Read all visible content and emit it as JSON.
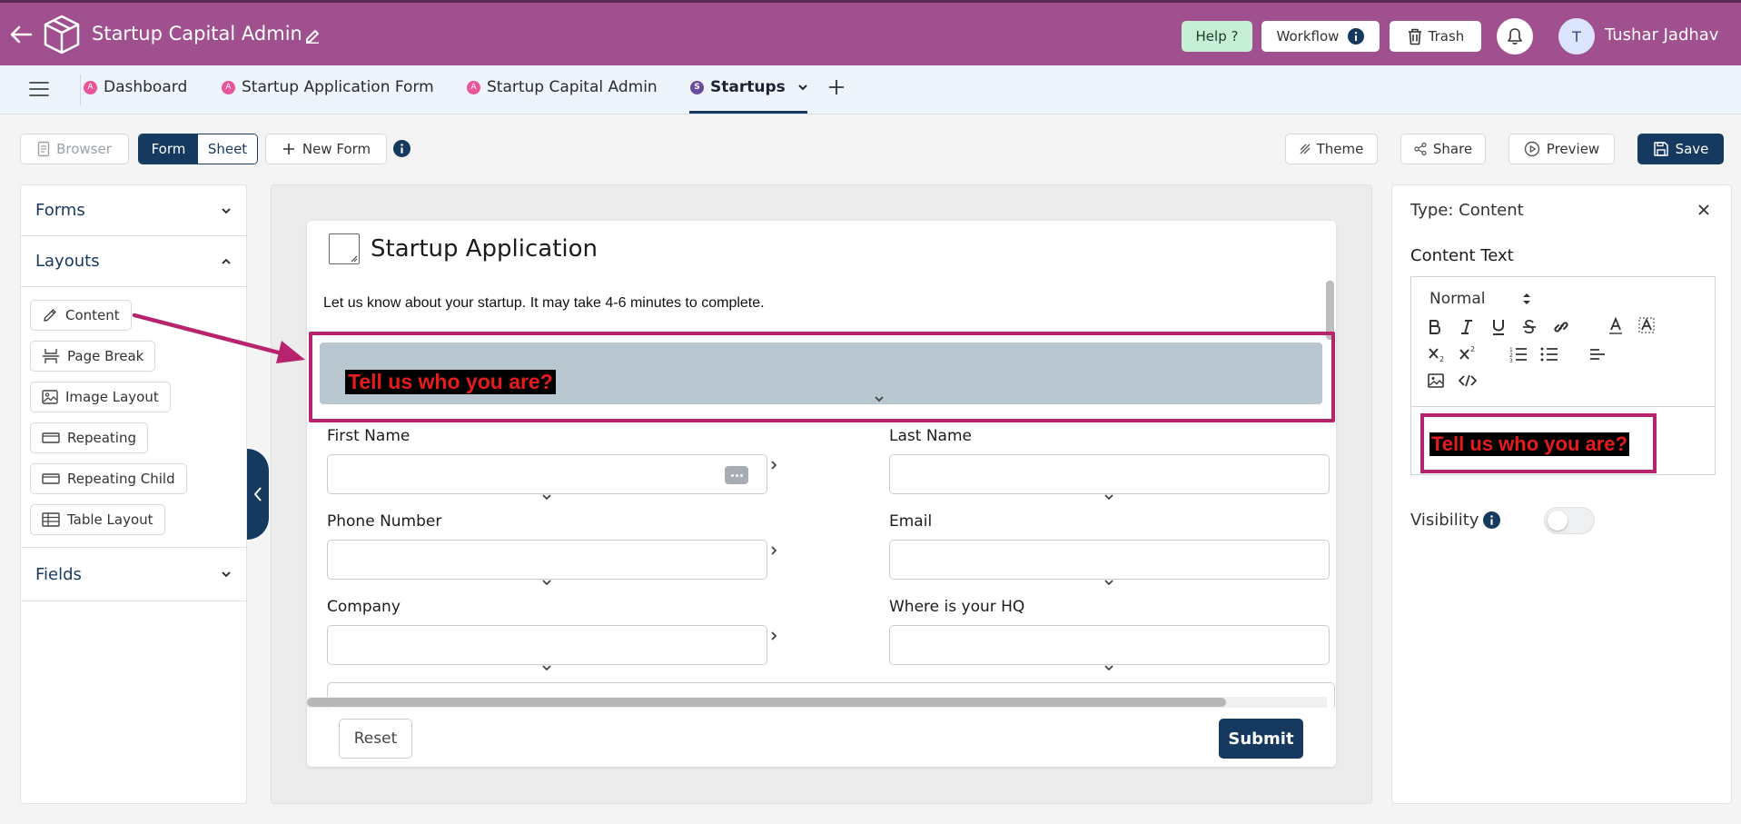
{
  "app": {
    "title": "Startup Capital Admin",
    "help_label": "Help ?",
    "workflow_label": "Workflow",
    "trash_label": "Trash",
    "user": {
      "initial": "T",
      "name": "Tushar Jadhav"
    }
  },
  "tabs": [
    {
      "label": "Dashboard",
      "badge": "A",
      "badge_color": "#e8559b"
    },
    {
      "label": "Startup Application Form",
      "badge": "A",
      "badge_color": "#e8559b"
    },
    {
      "label": "Startup Capital Admin",
      "badge": "A",
      "badge_color": "#e8559b"
    },
    {
      "label": "Startups",
      "badge": "S",
      "badge_color": "#6a4c9c",
      "active": true
    }
  ],
  "toolbar": {
    "browser_label": "Browser",
    "form_label": "Form",
    "sheet_label": "Sheet",
    "new_form_label": "New Form",
    "theme_label": "Theme",
    "share_label": "Share",
    "preview_label": "Preview",
    "save_label": "Save"
  },
  "sidebar": {
    "forms_label": "Forms",
    "layouts_label": "Layouts",
    "fields_label": "Fields",
    "layout_items": [
      "Content",
      "Page Break",
      "Image Layout",
      "Repeating",
      "Repeating Child",
      "Table Layout"
    ]
  },
  "form": {
    "title": "Startup Application",
    "description": "Let us know about your startup. It may take 4-6 minutes to complete.",
    "content_text": "Tell us who you are?",
    "fields": {
      "first_name": "First Name",
      "last_name": "Last Name",
      "phone": "Phone Number",
      "email": "Email",
      "company": "Company",
      "hq": "Where is your HQ"
    },
    "reset_label": "Reset",
    "submit_label": "Submit"
  },
  "panel": {
    "type_label": "Type: Content",
    "content_text_label": "Content Text",
    "format_value": "Normal",
    "editor_text": "Tell us who you are?",
    "visibility_label": "Visibility",
    "visibility_on": false
  },
  "colors": {
    "brand": "#a0508f",
    "primary": "#163a5f",
    "highlight": "#b8236e",
    "content_text": "#e61c1c"
  }
}
